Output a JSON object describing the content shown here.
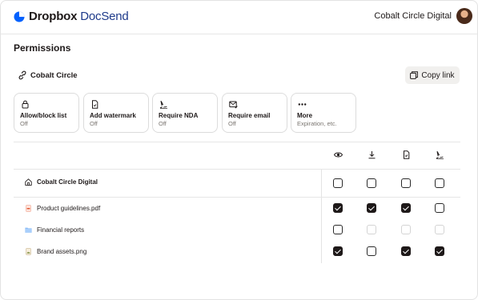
{
  "header": {
    "brand": "Dropbox",
    "product": "DocSend",
    "org_name": "Cobalt Circle Digital",
    "brand_color": "#0061fe"
  },
  "page": {
    "title": "Permissions"
  },
  "group": {
    "name": "Cobalt Circle",
    "icon": "link-icon"
  },
  "copy_link": {
    "label": "Copy link",
    "icon": "copy-icon"
  },
  "options": [
    {
      "title": "Allow/block list",
      "subtitle": "Off",
      "icon": "lock-icon"
    },
    {
      "title": "Add watermark",
      "subtitle": "Off",
      "icon": "document-icon"
    },
    {
      "title": "Require NDA",
      "subtitle": "Off",
      "icon": "signature-icon"
    },
    {
      "title": "Require email",
      "subtitle": "Off",
      "icon": "email-icon"
    },
    {
      "title": "More",
      "subtitle": "Expiration, etc.",
      "icon": "more-icon"
    }
  ],
  "columns": [
    "view-icon",
    "download-icon",
    "document-icon",
    "signature-icon"
  ],
  "rows": [
    {
      "label": "Cobalt Circle Digital",
      "icon": "home-icon",
      "checks": [
        "unchecked",
        "unchecked",
        "unchecked",
        "unchecked"
      ]
    },
    {
      "label": "Product guidelines.pdf",
      "icon": "pdf-file-icon",
      "checks": [
        "checked",
        "checked",
        "checked",
        "unchecked"
      ]
    },
    {
      "label": "Financial reports",
      "icon": "folder-icon",
      "checks": [
        "unchecked",
        "disabled",
        "disabled",
        "disabled"
      ]
    },
    {
      "label": "Brand assets.png",
      "icon": "image-file-icon",
      "checks": [
        "checked",
        "unchecked",
        "checked",
        "checked"
      ]
    }
  ]
}
